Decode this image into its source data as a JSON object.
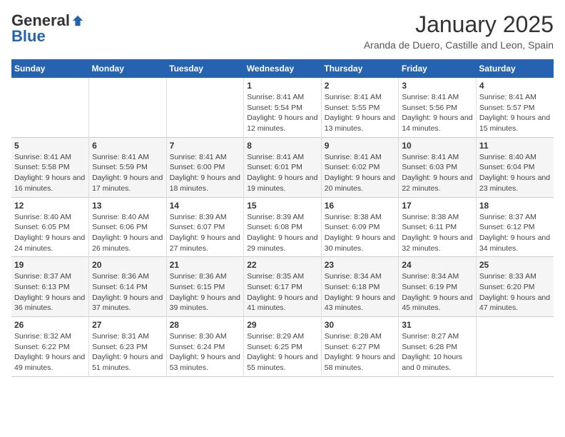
{
  "logo": {
    "general": "General",
    "blue": "Blue"
  },
  "title": "January 2025",
  "subtitle": "Aranda de Duero, Castille and Leon, Spain",
  "headers": [
    "Sunday",
    "Monday",
    "Tuesday",
    "Wednesday",
    "Thursday",
    "Friday",
    "Saturday"
  ],
  "weeks": [
    [
      {
        "day": "",
        "detail": ""
      },
      {
        "day": "",
        "detail": ""
      },
      {
        "day": "",
        "detail": ""
      },
      {
        "day": "1",
        "detail": "Sunrise: 8:41 AM\nSunset: 5:54 PM\nDaylight: 9 hours\nand 12 minutes."
      },
      {
        "day": "2",
        "detail": "Sunrise: 8:41 AM\nSunset: 5:55 PM\nDaylight: 9 hours\nand 13 minutes."
      },
      {
        "day": "3",
        "detail": "Sunrise: 8:41 AM\nSunset: 5:56 PM\nDaylight: 9 hours\nand 14 minutes."
      },
      {
        "day": "4",
        "detail": "Sunrise: 8:41 AM\nSunset: 5:57 PM\nDaylight: 9 hours\nand 15 minutes."
      }
    ],
    [
      {
        "day": "5",
        "detail": "Sunrise: 8:41 AM\nSunset: 5:58 PM\nDaylight: 9 hours\nand 16 minutes."
      },
      {
        "day": "6",
        "detail": "Sunrise: 8:41 AM\nSunset: 5:59 PM\nDaylight: 9 hours\nand 17 minutes."
      },
      {
        "day": "7",
        "detail": "Sunrise: 8:41 AM\nSunset: 6:00 PM\nDaylight: 9 hours\nand 18 minutes."
      },
      {
        "day": "8",
        "detail": "Sunrise: 8:41 AM\nSunset: 6:01 PM\nDaylight: 9 hours\nand 19 minutes."
      },
      {
        "day": "9",
        "detail": "Sunrise: 8:41 AM\nSunset: 6:02 PM\nDaylight: 9 hours\nand 20 minutes."
      },
      {
        "day": "10",
        "detail": "Sunrise: 8:41 AM\nSunset: 6:03 PM\nDaylight: 9 hours\nand 22 minutes."
      },
      {
        "day": "11",
        "detail": "Sunrise: 8:40 AM\nSunset: 6:04 PM\nDaylight: 9 hours\nand 23 minutes."
      }
    ],
    [
      {
        "day": "12",
        "detail": "Sunrise: 8:40 AM\nSunset: 6:05 PM\nDaylight: 9 hours\nand 24 minutes."
      },
      {
        "day": "13",
        "detail": "Sunrise: 8:40 AM\nSunset: 6:06 PM\nDaylight: 9 hours\nand 26 minutes."
      },
      {
        "day": "14",
        "detail": "Sunrise: 8:39 AM\nSunset: 6:07 PM\nDaylight: 9 hours\nand 27 minutes."
      },
      {
        "day": "15",
        "detail": "Sunrise: 8:39 AM\nSunset: 6:08 PM\nDaylight: 9 hours\nand 29 minutes."
      },
      {
        "day": "16",
        "detail": "Sunrise: 8:38 AM\nSunset: 6:09 PM\nDaylight: 9 hours\nand 30 minutes."
      },
      {
        "day": "17",
        "detail": "Sunrise: 8:38 AM\nSunset: 6:11 PM\nDaylight: 9 hours\nand 32 minutes."
      },
      {
        "day": "18",
        "detail": "Sunrise: 8:37 AM\nSunset: 6:12 PM\nDaylight: 9 hours\nand 34 minutes."
      }
    ],
    [
      {
        "day": "19",
        "detail": "Sunrise: 8:37 AM\nSunset: 6:13 PM\nDaylight: 9 hours\nand 36 minutes."
      },
      {
        "day": "20",
        "detail": "Sunrise: 8:36 AM\nSunset: 6:14 PM\nDaylight: 9 hours\nand 37 minutes."
      },
      {
        "day": "21",
        "detail": "Sunrise: 8:36 AM\nSunset: 6:15 PM\nDaylight: 9 hours\nand 39 minutes."
      },
      {
        "day": "22",
        "detail": "Sunrise: 8:35 AM\nSunset: 6:17 PM\nDaylight: 9 hours\nand 41 minutes."
      },
      {
        "day": "23",
        "detail": "Sunrise: 8:34 AM\nSunset: 6:18 PM\nDaylight: 9 hours\nand 43 minutes."
      },
      {
        "day": "24",
        "detail": "Sunrise: 8:34 AM\nSunset: 6:19 PM\nDaylight: 9 hours\nand 45 minutes."
      },
      {
        "day": "25",
        "detail": "Sunrise: 8:33 AM\nSunset: 6:20 PM\nDaylight: 9 hours\nand 47 minutes."
      }
    ],
    [
      {
        "day": "26",
        "detail": "Sunrise: 8:32 AM\nSunset: 6:22 PM\nDaylight: 9 hours\nand 49 minutes."
      },
      {
        "day": "27",
        "detail": "Sunrise: 8:31 AM\nSunset: 6:23 PM\nDaylight: 9 hours\nand 51 minutes."
      },
      {
        "day": "28",
        "detail": "Sunrise: 8:30 AM\nSunset: 6:24 PM\nDaylight: 9 hours\nand 53 minutes."
      },
      {
        "day": "29",
        "detail": "Sunrise: 8:29 AM\nSunset: 6:25 PM\nDaylight: 9 hours\nand 55 minutes."
      },
      {
        "day": "30",
        "detail": "Sunrise: 8:28 AM\nSunset: 6:27 PM\nDaylight: 9 hours\nand 58 minutes."
      },
      {
        "day": "31",
        "detail": "Sunrise: 8:27 AM\nSunset: 6:28 PM\nDaylight: 10 hours\nand 0 minutes."
      },
      {
        "day": "",
        "detail": ""
      }
    ]
  ]
}
